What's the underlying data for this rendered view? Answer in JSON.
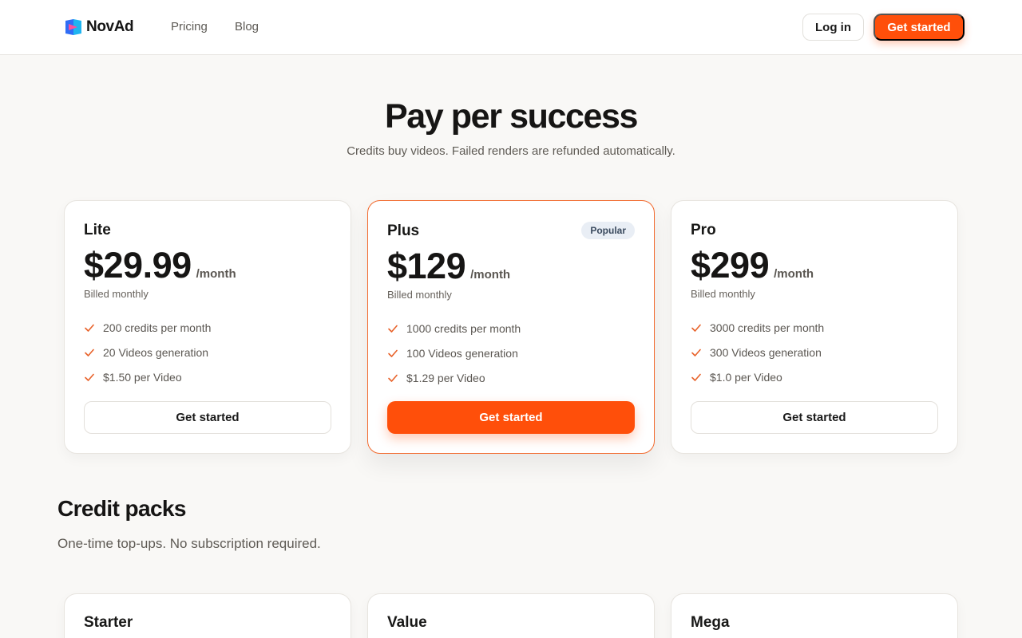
{
  "brand": {
    "name": "NovAd",
    "accent_color": "#ff4f0a"
  },
  "nav": {
    "links": [
      "Pricing",
      "Blog"
    ],
    "login_label": "Log in",
    "cta_label": "Get started"
  },
  "hero": {
    "title": "Pay per success",
    "subtitle": "Credits buy videos. Failed renders are refunded automatically."
  },
  "plans": [
    {
      "name": "Lite",
      "price": "$29.99",
      "period": "/month",
      "billing": "Billed monthly",
      "features": [
        "200 credits per month",
        "20 Videos generation",
        "$1.50 per Video"
      ],
      "cta": "Get started"
    },
    {
      "name": "Plus",
      "badge": "Popular",
      "price": "$129",
      "period": "/month",
      "billing": "Billed monthly",
      "features": [
        "1000 credits per month",
        "100 Videos generation",
        "$1.29 per Video"
      ],
      "cta": "Get started"
    },
    {
      "name": "Pro",
      "price": "$299",
      "period": "/month",
      "billing": "Billed monthly",
      "features": [
        "3000 credits per month",
        "300 Videos generation",
        "$1.0 per Video"
      ],
      "cta": "Get started"
    }
  ],
  "packs": {
    "title": "Credit packs",
    "subtitle": "One-time top-ups. No subscription required.",
    "items": [
      "Starter",
      "Value",
      "Mega"
    ]
  }
}
